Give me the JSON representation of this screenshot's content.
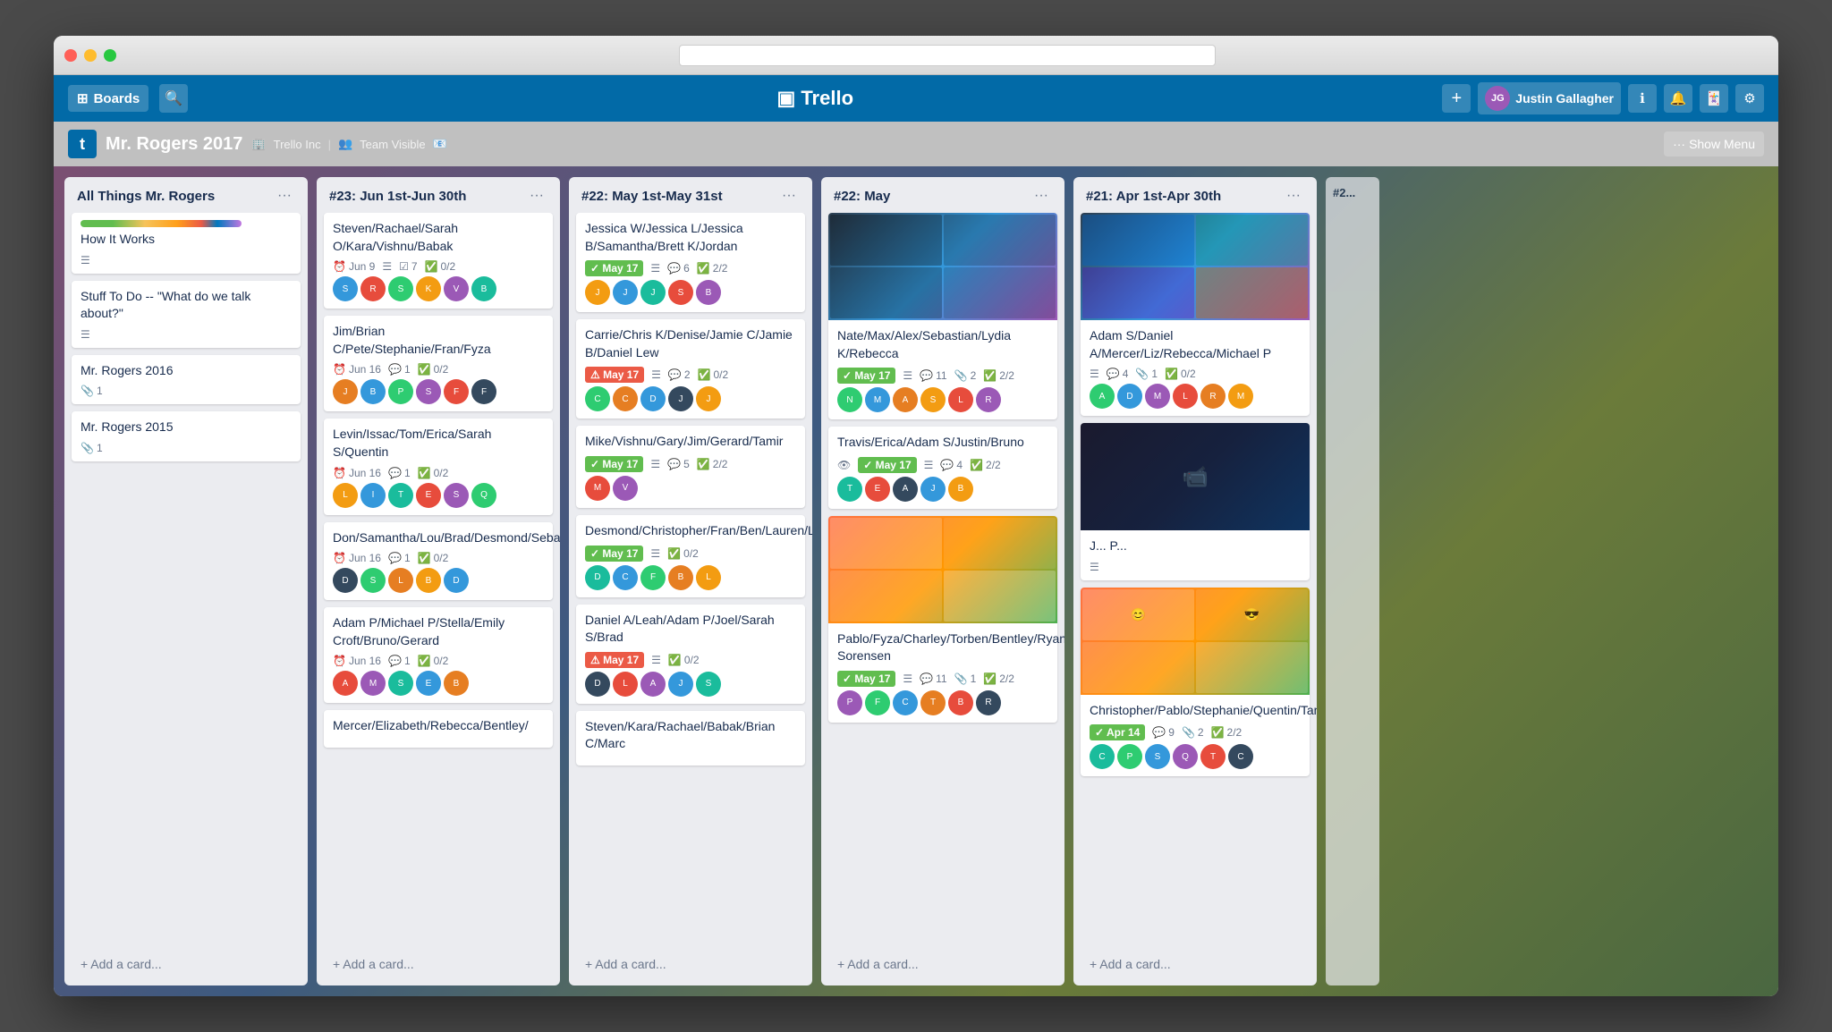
{
  "window": {
    "traffic_lights": [
      "red",
      "yellow",
      "green"
    ]
  },
  "header": {
    "boards_label": "Boards",
    "trello_logo": "Trello",
    "user_name": "Justin Gallagher",
    "add_icon": "+",
    "search_icon": "🔍"
  },
  "board": {
    "icon_text": "t",
    "title": "Mr. Rogers 2017",
    "org_name": "Trello Inc",
    "visibility": "Team Visible",
    "show_menu_label": "Show Menu",
    "dots_label": "···"
  },
  "lists": [
    {
      "id": "list-1",
      "title": "All Things Mr. Rogers",
      "cards": [
        {
          "id": "card-1-1",
          "title": "How It Works",
          "has_color_bar": true,
          "has_desc": true
        },
        {
          "id": "card-1-2",
          "title": "Stuff To Do -- \"What do we talk about?\"",
          "has_desc": true
        },
        {
          "id": "card-1-3",
          "title": "Mr. Rogers 2016",
          "attachments": "1"
        },
        {
          "id": "card-1-4",
          "title": "Mr. Rogers 2015",
          "attachments": "1"
        }
      ],
      "add_label": "Add a card..."
    },
    {
      "id": "list-2",
      "title": "#23: Jun 1st-Jun 30th",
      "cards": [
        {
          "id": "card-2-1",
          "title": "Steven/Rachael/Sarah O/Kara/Vishnu/Babak",
          "date": "Jun 9",
          "desc_icon": true,
          "checklist": "7",
          "check_progress": "0/2",
          "avatar_count": 6
        },
        {
          "id": "card-2-2",
          "title": "Jim/Brian C/Pete/Stephanie/Fran/Fyza",
          "date": "Jun 16",
          "comment": "1",
          "check_progress": "0/2",
          "avatar_count": 6
        },
        {
          "id": "card-2-3",
          "title": "Levin/Issac/Tom/Erica/Sarah S/Quentin",
          "date": "Jun 16",
          "comment": "1",
          "check_progress": "0/2",
          "avatar_count": 6
        },
        {
          "id": "card-2-4",
          "title": "Don/Samantha/Lou/Brad/Desmond/Sebastian",
          "date": "Jun 16",
          "comment": "1",
          "check_progress": "0/2",
          "avatar_count": 5
        },
        {
          "id": "card-2-5",
          "title": "Adam P/Michael P/Stella/Emily Croft/Bruno/Gerard",
          "date": "Jun 16",
          "comment": "1",
          "check_progress": "0/2",
          "avatar_count": 5
        },
        {
          "id": "card-2-6",
          "title": "Mercer/Elizabeth/Rebecca/Bentley/",
          "avatar_count": 0
        }
      ],
      "add_label": "Add a card..."
    },
    {
      "id": "list-3",
      "title": "#22: May 1st-May 31st",
      "cards": [
        {
          "id": "card-3-1",
          "title": "Jessica W/Jessica L/Jessica B/Samantha/Brett K/Jordan",
          "date_badge": "May 17",
          "date_badge_color": "green",
          "comments": "6",
          "check_progress": "2/2",
          "avatar_count": 5
        },
        {
          "id": "card-3-2",
          "title": "Carrie/Chris K/Denise/Jamie C/Jamie B/Daniel Lew",
          "date_badge": "May 17",
          "date_badge_color": "red",
          "comments": "2",
          "check_progress": "0/2",
          "avatar_count": 5
        },
        {
          "id": "card-3-3",
          "title": "Mike/Vishnu/Gary/Jim/Gerard/Tamir",
          "date_badge": "May 17",
          "date_badge_color": "green",
          "comments": "5",
          "check_progress": "2/2",
          "avatar_count": 2
        },
        {
          "id": "card-3-4",
          "title": "Desmond/Christopher/Fran/Ben/Lauren/Levin",
          "date_badge": "May 17",
          "date_badge_color": "green",
          "check_progress": "0/2",
          "avatar_count": 5
        },
        {
          "id": "card-3-5",
          "title": "Daniel A/Leah/Adam P/Joel/Sarah S/Brad",
          "date_badge": "May 17",
          "date_badge_color": "red",
          "check_progress": "0/2",
          "avatar_count": 5
        },
        {
          "id": "card-3-6",
          "title": "Steven/Kara/Rachael/Babak/Brian C/Marc",
          "avatar_count": 0
        }
      ],
      "add_label": "Add a card..."
    },
    {
      "id": "list-4",
      "title": "#22: May",
      "cards": [
        {
          "id": "card-4-1",
          "has_image": true,
          "image_class": "img1",
          "title": "Nate/Max/Alex/Sebastian/Lydia K/Rebecca",
          "date_badge": "May 17",
          "date_badge_color": "green",
          "desc_icon": true,
          "comments": "11",
          "attachments": "2",
          "check_progress": "2/2",
          "avatar_count": 6
        },
        {
          "id": "card-4-2",
          "title": "Travis/Erica/Adam S/Justin/Bruno",
          "eye_icon": true,
          "date_badge": "May 17",
          "date_badge_color": "green",
          "desc_icon": true,
          "comments": "4",
          "check_progress": "2/2",
          "avatar_count": 5
        },
        {
          "id": "card-4-3",
          "has_image": true,
          "image_class": "img2",
          "title": "Pablo/Fyza/Charley/Torben/Bentley/Ryan Sorensen",
          "date_badge": "May 17",
          "date_badge_color": "green",
          "desc_icon": true,
          "comments": "11",
          "attachments": "1",
          "check_progress": "2/2",
          "avatar_count": 6
        }
      ],
      "add_label": "Add a card..."
    },
    {
      "id": "list-5",
      "title": "#21: Apr 1st-Apr 30th",
      "cards": [
        {
          "id": "card-5-1",
          "has_image": true,
          "image_class": "img1",
          "title": "Adam S/Daniel A/Mercer/Liz/Rebecca/Michael P",
          "desc_icon": true,
          "comments": "4",
          "comment_badge": "1",
          "check_progress": "0/2",
          "avatar_count": 6
        },
        {
          "id": "card-5-2",
          "has_image": true,
          "image_class": "img3",
          "title": "J... P...",
          "avatar_count": 0
        },
        {
          "id": "card-5-3",
          "has_image": true,
          "image_class": "img2",
          "title": "Christopher/Pablo/Stephanie/Quentin/Tamir/Chad",
          "date_badge": "Apr 14",
          "date_badge_color": "green",
          "comments": "9",
          "attachments": "2",
          "check_progress": "2/2",
          "avatar_count": 6
        }
      ],
      "add_label": "Add a card..."
    }
  ]
}
